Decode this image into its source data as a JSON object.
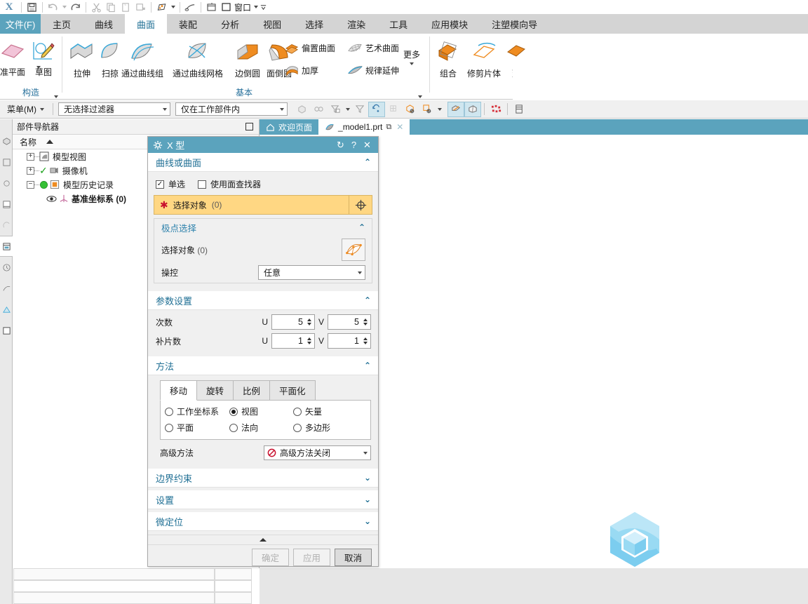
{
  "quick_access": {
    "app_glyph": "X",
    "buttons": [
      {
        "name": "save-icon",
        "glyph": "save"
      },
      {
        "name": "undo-icon",
        "glyph": "undo"
      },
      {
        "name": "undo-dropdown-icon",
        "glyph": "caret"
      },
      {
        "name": "redo-icon",
        "glyph": "redo"
      },
      {
        "name": "cut-icon",
        "glyph": "scissors"
      },
      {
        "name": "copy-icon",
        "glyph": "copy"
      },
      {
        "name": "paste-icon",
        "glyph": "paste"
      },
      {
        "name": "paste-special-icon",
        "glyph": "paste-special"
      },
      {
        "name": "edit-object-display-icon",
        "glyph": "display"
      },
      {
        "name": "display-dropdown-icon",
        "glyph": "caret"
      },
      {
        "name": "paintbrush-icon",
        "glyph": "brush"
      },
      {
        "name": "window-layout-icon",
        "glyph": "window"
      },
      {
        "name": "window-blank-icon",
        "glyph": "square"
      },
      {
        "name": "window-label",
        "glyph": "window-cn"
      },
      {
        "name": "window-dropdown-icon",
        "glyph": "caret"
      },
      {
        "name": "customize-icon",
        "glyph": "bars-caret"
      }
    ],
    "window_label": "窗口"
  },
  "ribbon": {
    "file_tab": "文件(F)",
    "tabs": [
      {
        "label": "主页",
        "active": false
      },
      {
        "label": "曲线",
        "active": false
      },
      {
        "label": "曲面",
        "active": true
      },
      {
        "label": "装配",
        "active": false
      },
      {
        "label": "分析",
        "active": false
      },
      {
        "label": "视图",
        "active": false
      },
      {
        "label": "选择",
        "active": false
      },
      {
        "label": "渲染",
        "active": false
      },
      {
        "label": "工具",
        "active": false
      },
      {
        "label": "应用模块",
        "active": false
      },
      {
        "label": "注塑模向导",
        "active": false
      }
    ],
    "groups": [
      {
        "name": "construct",
        "label": "构造",
        "items": [
          {
            "label": "准平面",
            "icon": "datum-plane-icon"
          },
          {
            "label": "草图",
            "icon": "sketch-icon"
          }
        ]
      },
      {
        "name": "basic",
        "label": "基本",
        "items": [
          {
            "label": "拉伸",
            "icon": "extrude-icon"
          },
          {
            "label": "扫掠",
            "icon": "sweep-icon"
          },
          {
            "label": "通过曲线组",
            "icon": "through-curves-icon"
          },
          {
            "label": "通过曲线网格",
            "icon": "through-curve-mesh-icon"
          },
          {
            "label": "边倒圆",
            "icon": "edge-blend-icon"
          },
          {
            "label": "面倒圆",
            "icon": "face-blend-icon"
          },
          {
            "label": "偏置曲面",
            "icon": "offset-surface-icon"
          },
          {
            "label": "艺术曲面",
            "icon": "studio-surface-icon"
          },
          {
            "label": "加厚",
            "icon": "thicken-icon"
          },
          {
            "label": "规律延伸",
            "icon": "law-extension-icon"
          },
          {
            "label": "更多",
            "icon": "more-icon"
          }
        ]
      },
      {
        "name": "surface-operation",
        "label": "",
        "items": [
          {
            "label": "组合",
            "icon": "combine-icon"
          },
          {
            "label": "修剪片体",
            "icon": "trim-sheet-icon"
          },
          {
            "label": "延伸",
            "icon": "extend-icon"
          }
        ]
      }
    ]
  },
  "selection_bar": {
    "menu_label": "菜单(M)",
    "filter_value": "无选择过滤器",
    "scope_value": "仅在工作部件内",
    "tools": [
      {
        "name": "select-solid-icon",
        "active": false
      },
      {
        "name": "select-feature-icon",
        "active": false
      },
      {
        "name": "filter-list-icon",
        "active": false
      },
      {
        "name": "filter-dropdown-icon",
        "active": false
      },
      {
        "name": "clear-filter-icon",
        "active": false
      },
      {
        "name": "move-object-icon",
        "active": true
      },
      {
        "name": "grid-snap-icon",
        "active": false
      },
      {
        "name": "wcs-origin-icon",
        "active": false
      },
      {
        "name": "wcs-dynamics-icon",
        "active": false
      },
      {
        "name": "wcs-dropdown-icon",
        "active": false
      },
      {
        "name": "shaded-display-icon",
        "active": true
      },
      {
        "name": "wireframe-display-icon",
        "active": true
      },
      {
        "name": "pattern-icon",
        "active": false
      },
      {
        "name": "layer-settings-icon",
        "active": false
      }
    ]
  },
  "navigator": {
    "panel_title": "部件导航器",
    "column_header": "名称",
    "rows": [
      {
        "label": "模型视图",
        "expander": "+",
        "icon": "model-views-icon",
        "check": false,
        "indent": 0
      },
      {
        "label": "摄像机",
        "expander": "+",
        "icon": "cameras-icon",
        "check": true,
        "indent": 0
      },
      {
        "label": "模型历史记录",
        "expander": "-",
        "icon": "history-icon",
        "check": "green",
        "indent": 0
      },
      {
        "label": "基准坐标系 (0)",
        "expander": "",
        "icon": "datum-csys-icon",
        "check": "eye",
        "indent": 1
      }
    ]
  },
  "document_tabs": [
    {
      "label": "欢迎页面",
      "icon": "home-icon",
      "active": false,
      "closable": false
    },
    {
      "label": "_model1.prt",
      "icon": "part-icon",
      "active": true,
      "closable": true,
      "modified_glyph": "⧉"
    }
  ],
  "dialog": {
    "title": "X 型",
    "title_icon": "gear-icon",
    "controls": [
      {
        "name": "reset-button",
        "glyph": "↻"
      },
      {
        "name": "help-button",
        "glyph": "?"
      },
      {
        "name": "close-button",
        "glyph": "✕"
      }
    ],
    "sections": [
      {
        "id": "curve-or-surface",
        "title": "曲线或曲面",
        "expanded": true,
        "checkboxes": [
          {
            "label": "单选",
            "checked": true
          },
          {
            "label": "使用面查找器",
            "checked": false
          }
        ],
        "select_object": {
          "label": "选择对象",
          "count": "(0)",
          "required": true,
          "icon": "crosshair-icon"
        },
        "subsection": {
          "title": "极点选择",
          "expanded": true,
          "field_label": "选择对象",
          "field_count": "(0)",
          "field_icon": "pole-select-icon",
          "dropdown_label": "操控",
          "dropdown_value": "任意"
        }
      },
      {
        "id": "parameter-settings",
        "title": "参数设置",
        "expanded": true,
        "params": [
          {
            "label": "次数",
            "u_key": "U",
            "u_value": "5",
            "v_key": "V",
            "v_value": "5"
          },
          {
            "label": "补片数",
            "u_key": "U",
            "u_value": "1",
            "v_key": "V",
            "v_value": "1"
          }
        ]
      },
      {
        "id": "method",
        "title": "方法",
        "expanded": true,
        "tabs": [
          {
            "label": "移动",
            "active": true
          },
          {
            "label": "旋转",
            "active": false
          },
          {
            "label": "比例",
            "active": false
          },
          {
            "label": "平面化",
            "active": false
          }
        ],
        "radios": [
          {
            "label": "工作坐标系",
            "selected": false
          },
          {
            "label": "视图",
            "selected": true
          },
          {
            "label": "矢量",
            "selected": false
          },
          {
            "label": "平面",
            "selected": false
          },
          {
            "label": "法向",
            "selected": false
          },
          {
            "label": "多边形",
            "selected": false
          }
        ],
        "advanced_label": "高级方法",
        "advanced_value": "高级方法关闭",
        "advanced_icon": "no-entry-icon"
      },
      {
        "id": "boundary-constraint",
        "title": "边界约束",
        "expanded": false
      },
      {
        "id": "settings",
        "title": "设置",
        "expanded": false
      },
      {
        "id": "fine-positioning",
        "title": "微定位",
        "expanded": false
      }
    ],
    "footer_buttons": [
      {
        "label": "确定",
        "enabled": false,
        "name": "ok-button"
      },
      {
        "label": "应用",
        "enabled": false,
        "name": "apply-button"
      },
      {
        "label": "取消",
        "enabled": true,
        "name": "cancel-button"
      }
    ]
  },
  "colors": {
    "accent": "#5ba3bd",
    "highlight_field": "#ffd783",
    "section_title": "#1f6f94",
    "ribbon_tab_bg": "#d4d4d4",
    "logo": "#7fd0f0"
  }
}
